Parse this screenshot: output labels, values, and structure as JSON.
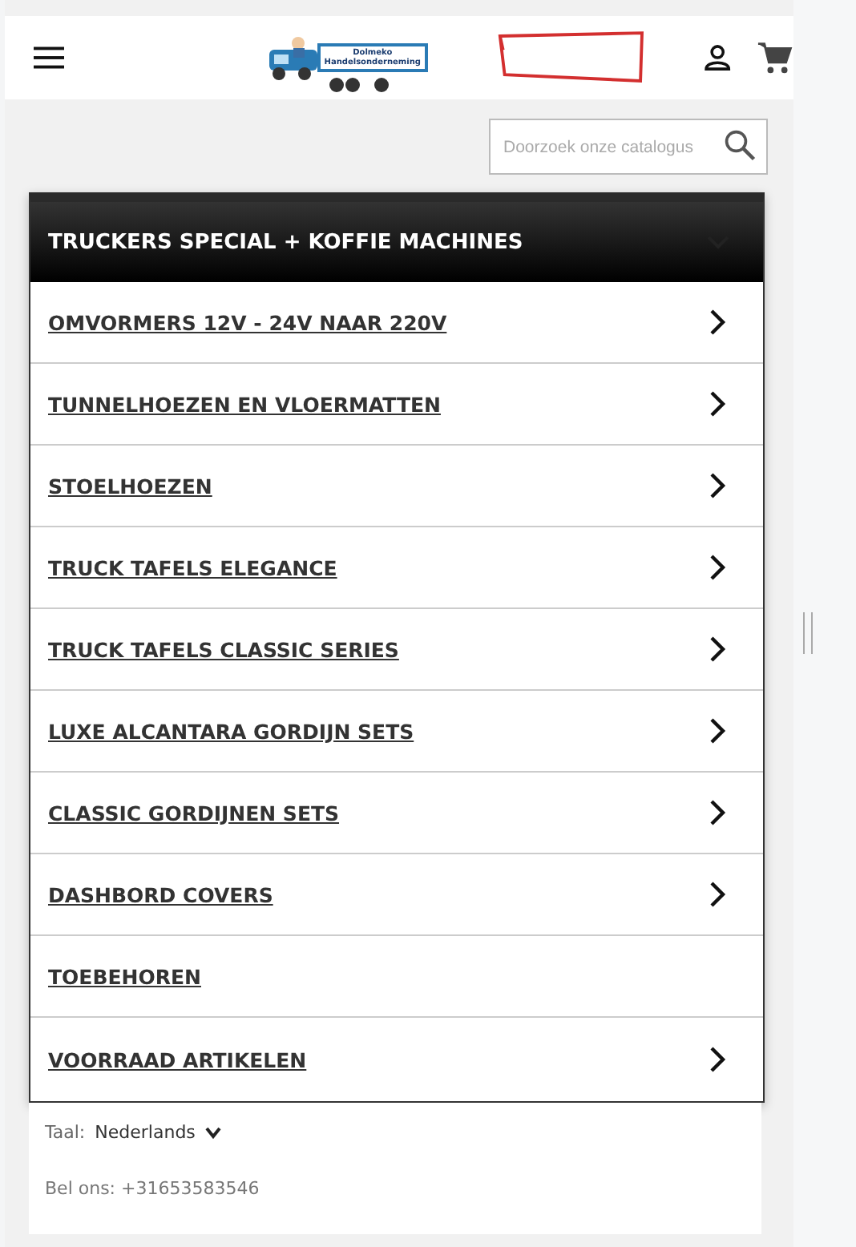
{
  "header": {
    "logo_lines": [
      "Dolmeko",
      "Handelsonderneming"
    ]
  },
  "search": {
    "placeholder": "Doorzoek onze catalogus"
  },
  "menu": {
    "title": "TRUCKERS SPECIAL + KOFFIE MACHINES",
    "expanded": true,
    "items": [
      {
        "label": "OMVORMERS 12V - 24V NAAR 220V",
        "has_children": true
      },
      {
        "label": "TUNNELHOEZEN EN VLOERMATTEN",
        "has_children": true
      },
      {
        "label": "STOELHOEZEN",
        "has_children": true
      },
      {
        "label": "TRUCK TAFELS ELEGANCE",
        "has_children": true
      },
      {
        "label": "TRUCK TAFELS CLASSIC SERIES",
        "has_children": true
      },
      {
        "label": "LUXE ALCANTARA GORDIJN SETS",
        "has_children": true
      },
      {
        "label": "CLASSIC GORDIJNEN SETS",
        "has_children": true
      },
      {
        "label": "DASHBORD COVERS",
        "has_children": true
      },
      {
        "label": "TOEBEHOREN",
        "has_children": false
      },
      {
        "label": "VOORRAAD ARTIKELEN",
        "has_children": true
      }
    ]
  },
  "footer": {
    "language_label": "Taal:",
    "language": "Nederlands",
    "phone": "Bel ons: +31653583546"
  }
}
